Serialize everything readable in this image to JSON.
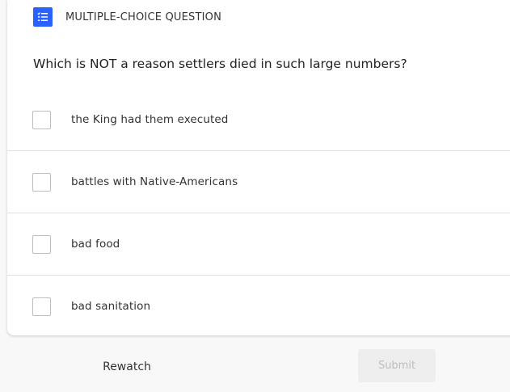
{
  "question_type": {
    "label": "MULTIPLE-CHOICE QUESTION",
    "icon": "checklist-icon",
    "color": "#2962ff"
  },
  "question": {
    "text": "Which is NOT a reason settlers died in such large numbers?"
  },
  "options": [
    {
      "label": "the King had them executed",
      "checked": false
    },
    {
      "label": "battles with Native-Americans",
      "checked": false
    },
    {
      "label": "bad food",
      "checked": false
    },
    {
      "label": "bad sanitation",
      "checked": false
    }
  ],
  "actions": {
    "rewatch_label": "Rewatch",
    "submit_label": "Submit",
    "submit_enabled": false
  }
}
